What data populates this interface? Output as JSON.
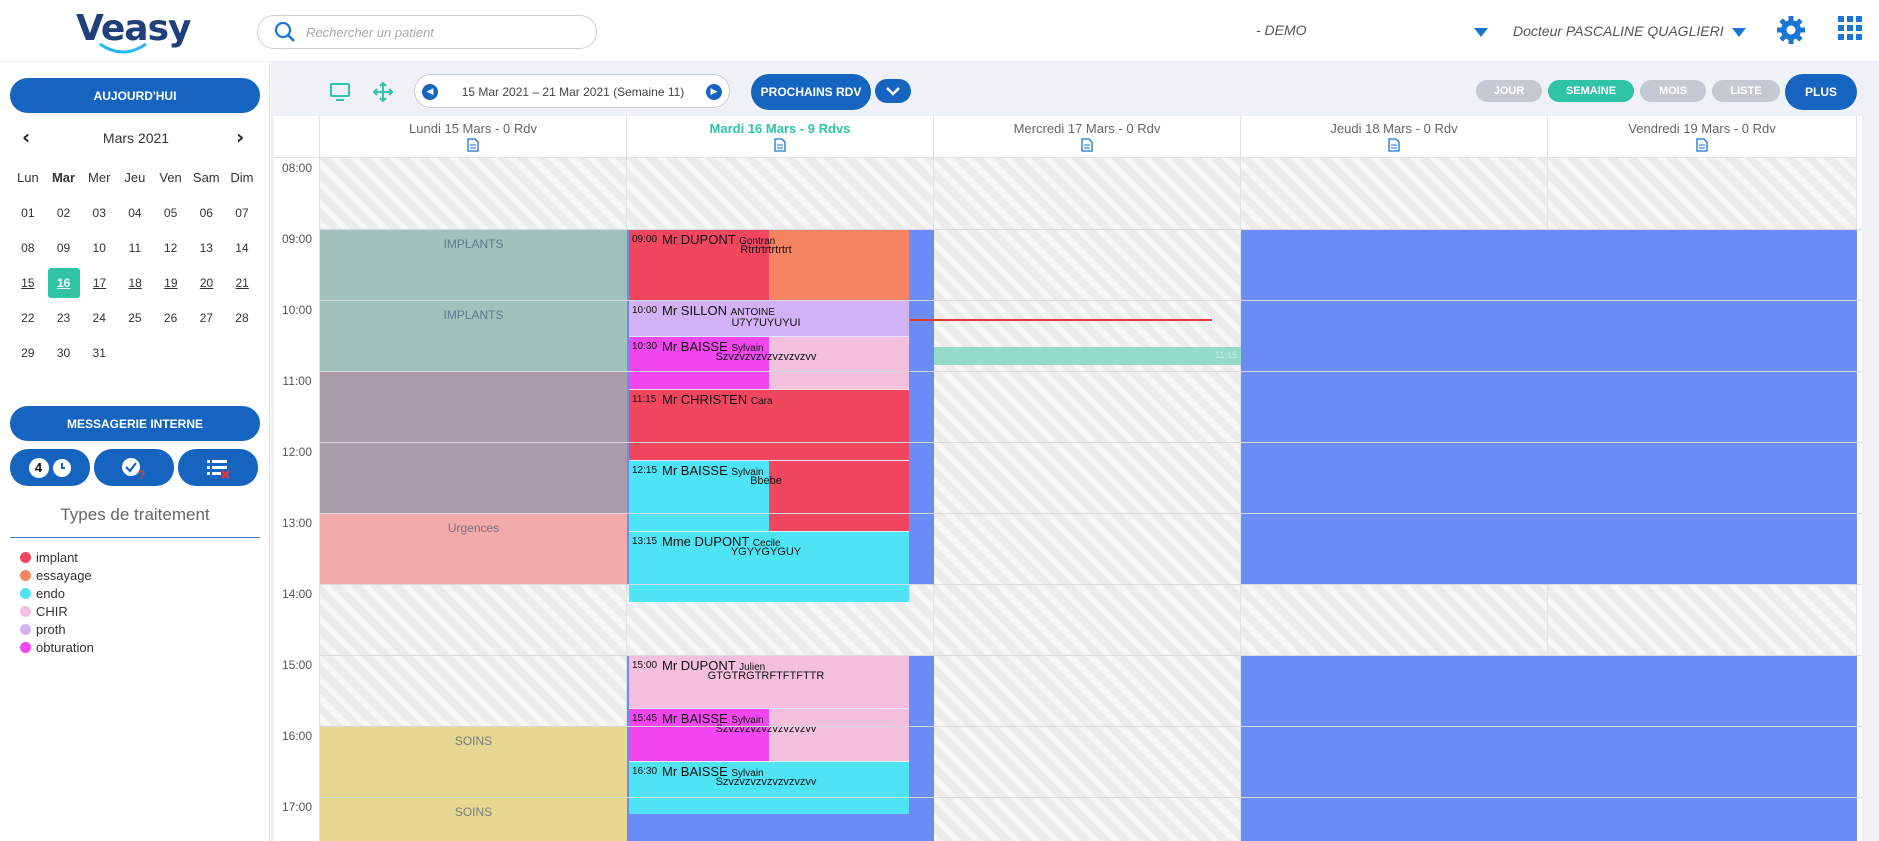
{
  "header": {
    "logo_text": "Veasy",
    "search_placeholder": "Rechercher un patient",
    "account": "- DEMO",
    "doctor": "Docteur PASCALINE QUAGLIERI",
    "icons": [
      "search-icon",
      "caret-down-icon",
      "gear-icon",
      "apps-grid-icon"
    ]
  },
  "sidebar": {
    "today_label": "AUJOURD'HUI",
    "month_title": "Mars 2021",
    "weekdays": [
      "Lun",
      "Mar",
      "Mer",
      "Jeu",
      "Ven",
      "Sam",
      "Dim"
    ],
    "weeks": [
      [
        "01",
        "02",
        "03",
        "04",
        "05",
        "06",
        "07"
      ],
      [
        "08",
        "09",
        "10",
        "11",
        "12",
        "13",
        "14"
      ],
      [
        "15",
        "16",
        "17",
        "18",
        "19",
        "20",
        "21"
      ],
      [
        "22",
        "23",
        "24",
        "25",
        "26",
        "27",
        "28"
      ],
      [
        "29",
        "30",
        "31",
        "",
        "",
        "",
        ""
      ]
    ],
    "selected_day": "16",
    "messagerie_label": "MESSAGERIE INTERNE",
    "pending_count": "4",
    "types_title": "Types de traitement",
    "types": [
      {
        "label": "implant",
        "color": "#f0475f"
      },
      {
        "label": "essayage",
        "color": "#f78462"
      },
      {
        "label": "endo",
        "color": "#4fe4f5"
      },
      {
        "label": "CHIR",
        "color": "#f4c0de"
      },
      {
        "label": "proth",
        "color": "#d3b1f5"
      },
      {
        "label": "obturation",
        "color": "#f247f0"
      }
    ]
  },
  "toolbar": {
    "date_range": "15 Mar 2021 – 21 Mar 2021 (Semaine 11)",
    "prochains_label": "PROCHAINS RDV",
    "views": [
      "JOUR",
      "SEMAINE",
      "MOIS",
      "LISTE"
    ],
    "active_view": "SEMAINE",
    "plus_label": "PLUS"
  },
  "calendar": {
    "days": [
      "Lundi 15 Mars - 0 Rdv",
      "Mardi 16 Mars - 9 Rdvs",
      "Mercredi 17 Mars - 0 Rdv",
      "Jeudi 18 Mars - 0 Rdv",
      "Vendredi 19 Mars - 0 Rdv"
    ],
    "today_index": 1,
    "hours": [
      "08:00",
      "09:00",
      "10:00",
      "11:00",
      "12:00",
      "13:00",
      "14:00",
      "15:00",
      "16:00",
      "17:00"
    ],
    "slots": {
      "implants_1": "IMPLANTS",
      "implants_2": "IMPLANTS",
      "urgences": "Urgences",
      "soins_1": "SOINS",
      "soins_2": "SOINS",
      "wed_marker": "11:15"
    },
    "appointments": [
      {
        "time": "09:00",
        "name": "Mr DUPONT",
        "first": "Gontran",
        "note": "Rtrtrtrtrtrtrt"
      },
      {
        "time": "10:00",
        "name": "Mr SILLON",
        "first": "ANTOINE",
        "note": "U7Y7UYUYUI"
      },
      {
        "time": "10:30",
        "name": "Mr BAISSE",
        "first": "Sylvain",
        "note": "Szvzvzvzvzvzvzvzvv"
      },
      {
        "time": "11:15",
        "name": "Mr CHRISTEN",
        "first": "Cara",
        "note": ""
      },
      {
        "time": "12:15",
        "name": "Mr BAISSE",
        "first": "Sylvain",
        "note": "Bbebe"
      },
      {
        "time": "13:15",
        "name": "Mme DUPONT",
        "first": "Cecile",
        "note": "YGYYGYGUY"
      },
      {
        "time": "15:00",
        "name": "Mr DUPONT",
        "first": "Julien",
        "note": "GTGTRGTRFTFTFTTR"
      },
      {
        "time": "15:45",
        "name": "Mr BAISSE",
        "first": "Sylvain",
        "note": "Szvzvzvzvzvzvzvzvv"
      },
      {
        "time": "16:30",
        "name": "Mr BAISSE",
        "first": "Sylvain",
        "note": "Szvzvzvzvzvzvzvzvv"
      }
    ]
  }
}
